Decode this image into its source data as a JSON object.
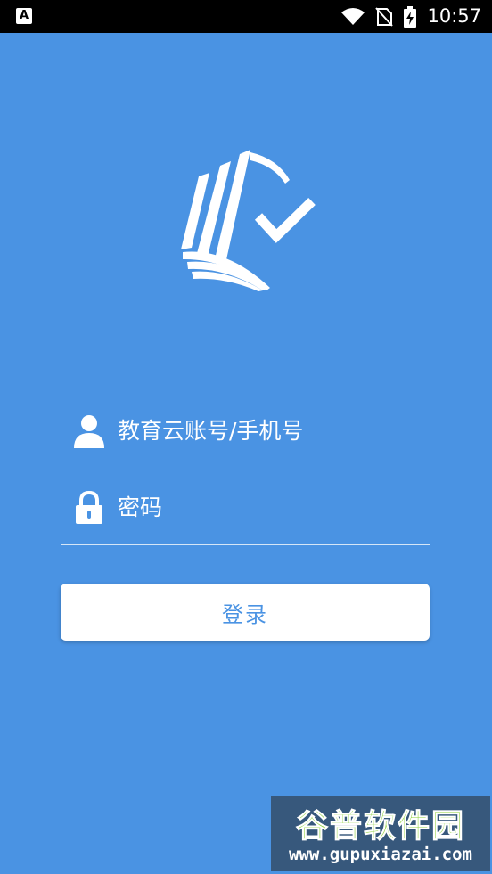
{
  "status_bar": {
    "notification_icon": "A",
    "time": "10:57",
    "icons": [
      "wifi-icon",
      "no-sim-icon",
      "battery-charging-icon"
    ]
  },
  "app": {
    "logo_icon": "book-check-logo"
  },
  "login_form": {
    "account": {
      "placeholder": "教育云账号/手机号",
      "value": "",
      "icon": "user-icon"
    },
    "password": {
      "placeholder": "密码",
      "value": "",
      "icon": "lock-icon"
    },
    "submit_label": "登录"
  },
  "watermark": {
    "title": "谷普软件园",
    "url": "www.gupuxiazai.com"
  },
  "colors": {
    "background": "#4a93e3",
    "button_text": "#4a93e3",
    "status_bar": "#000000"
  }
}
